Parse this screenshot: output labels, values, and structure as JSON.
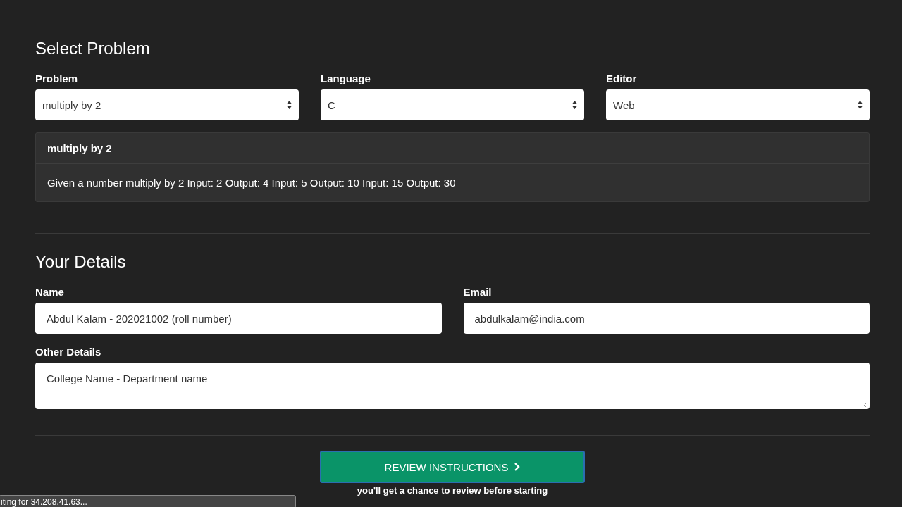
{
  "select_problem": {
    "heading": "Select Problem",
    "fields": [
      {
        "label": "Problem",
        "value": "multiply by 2"
      },
      {
        "label": "Language",
        "value": "C"
      },
      {
        "label": "Editor",
        "value": "Web"
      }
    ],
    "problem_panel": {
      "title": "multiply by 2",
      "description": "Given a number multiply by 2 Input: 2 Output: 4 Input: 5 Output: 10 Input: 15 Output: 30"
    }
  },
  "your_details": {
    "heading": "Your Details",
    "name": {
      "label": "Name",
      "value": "Abdul Kalam - 202021002 (roll number)"
    },
    "email": {
      "label": "Email",
      "value": "abdulkalam@india.com"
    },
    "other_details": {
      "label": "Other Details",
      "value": "College Name - Department name"
    }
  },
  "review_button": {
    "label": "REVIEW INSTRUCTIONS"
  },
  "review_note": "you'll get a chance to review before starting",
  "status_bar": "iting for 34.208.41.63..."
}
